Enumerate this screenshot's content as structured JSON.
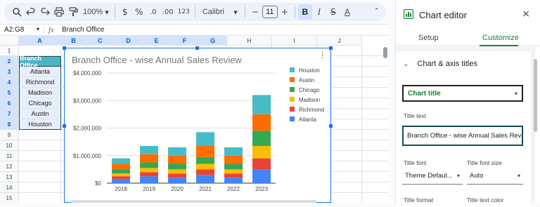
{
  "toolbar": {
    "zoom": "100%",
    "currency": "$",
    "percent": "%",
    "decrease_decimal": ".0",
    "increase_decimal": ".00",
    "number_format": "123",
    "font": "Calibri",
    "font_size": "11",
    "minus": "−",
    "plus": "+",
    "bold": "B",
    "italic": "I",
    "strike": "S",
    "text_color": "A"
  },
  "formula_bar": {
    "name_box": "A2:G8",
    "fx": "fx",
    "content": "Branch Office"
  },
  "sheet": {
    "columns": [
      "A",
      "B",
      "C",
      "D",
      "E",
      "F",
      "G",
      "H",
      "I",
      "J"
    ],
    "rows": [
      "1",
      "2",
      "3",
      "4",
      "5",
      "6",
      "7",
      "8",
      "9",
      "10",
      "11",
      "12",
      "13",
      "14",
      "15"
    ],
    "header_cell": "Branch Office",
    "branches": [
      "Atlanta",
      "Richmond",
      "Madison",
      "Chicago",
      "Austin",
      "Houston"
    ],
    "colors": {
      "header_fill": "#4ab5c4",
      "selection": "#d3e3fd",
      "accent": "#1a73e8"
    }
  },
  "chart_data": {
    "type": "bar",
    "stacked": true,
    "title": "Branch Office - wise Annual Sales Review",
    "categories": [
      "2018",
      "2019",
      "2020",
      "2021",
      "2022",
      "2023"
    ],
    "y_ticks": [
      "$4,000,000",
      "$3,000,000",
      "$2,000,000",
      "$1,000,000",
      "$0"
    ],
    "ylim": [
      0,
      4000000
    ],
    "legend_position": "right",
    "series": [
      {
        "name": "Atlanta",
        "color": "#4285f4",
        "values": [
          150000,
          250000,
          200000,
          300000,
          200000,
          500000
        ]
      },
      {
        "name": "Richmond",
        "color": "#ea4335",
        "values": [
          100000,
          150000,
          150000,
          200000,
          150000,
          400000
        ]
      },
      {
        "name": "Madison",
        "color": "#fbbc04",
        "values": [
          100000,
          150000,
          150000,
          200000,
          150000,
          450000
        ]
      },
      {
        "name": "Chicago",
        "color": "#34a853",
        "values": [
          150000,
          200000,
          200000,
          250000,
          200000,
          550000
        ]
      },
      {
        "name": "Austin",
        "color": "#ff6d01",
        "values": [
          200000,
          300000,
          300000,
          400000,
          300000,
          600000
        ]
      },
      {
        "name": "Houston",
        "color": "#46bdc6",
        "values": [
          200000,
          300000,
          300000,
          500000,
          300000,
          700000
        ]
      }
    ],
    "legend": [
      "Houston",
      "Austin",
      "Chicago",
      "Madison",
      "Richmond",
      "Atlanta"
    ]
  },
  "panel": {
    "title": "Chart editor",
    "close": "×",
    "tabs": [
      "Setup",
      "Customize"
    ],
    "section": "Chart & axis titles",
    "dropdown": "Chart title",
    "title_text_label": "Title text",
    "title_text_value": "Branch Office - wise Annual Sales Review",
    "title_font_label": "Title font",
    "title_font_value": "Theme Defaul...",
    "title_size_label": "Title font size",
    "title_size_value": "Auto",
    "title_format_label": "Title format",
    "title_color_label": "Title text color"
  }
}
